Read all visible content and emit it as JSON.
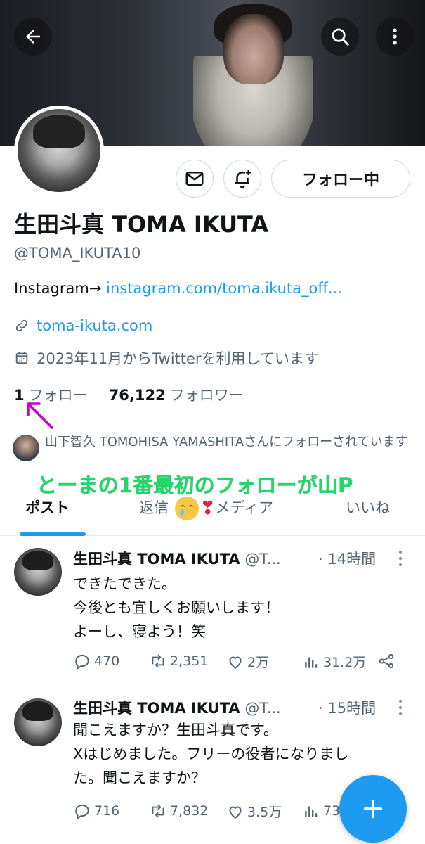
{
  "profile": {
    "display_name": "生田斗真 TOMA IKUTA",
    "handle": "@TOMA_IKUTA10",
    "bio_prefix": "Instagram→ ",
    "bio_link": "instagram.com/toma.ikuta_off...",
    "website": "toma-ikuta.com",
    "joined": "2023年11月からTwitterを利用しています",
    "following_count": "1",
    "following_label": "フォロー",
    "followers_count": "76,122",
    "followers_label": "フォロワー",
    "followed_by": "山下智久 TOMOHISA YAMASHITAさんにフォローされています"
  },
  "header": {
    "follow_button": "フォロー中"
  },
  "annotation": {
    "caption": "とーまの1番最初のフォローが山P",
    "arrow_color": "#cc00cc"
  },
  "tabs": {
    "posts": "ポスト",
    "replies": "返信",
    "media": "メディア",
    "likes": "いいね"
  },
  "posts": [
    {
      "author": "生田斗真 TOMA IKUTA",
      "handle_short": "@T...",
      "time": "· 14時間",
      "lines": [
        "できたできた。",
        "今後とも宜しくお願いします！",
        "よーし、寝よう！笑"
      ],
      "replies": "470",
      "reposts": "2,351",
      "likes": "2万",
      "views": "31.2万"
    },
    {
      "author": "生田斗真 TOMA IKUTA",
      "handle_short": "@T...",
      "time": "· 15時間",
      "lines": [
        "聞こえますか？生田斗真です。",
        "Xはじめました。フリーの役者になりまし",
        "た。聞こえますか？"
      ],
      "replies": "716",
      "reposts": "7,832",
      "likes": "3.5万",
      "views": "73"
    }
  ],
  "colors": {
    "accent": "#1d9bf0",
    "caption_green": "#22d66a"
  }
}
